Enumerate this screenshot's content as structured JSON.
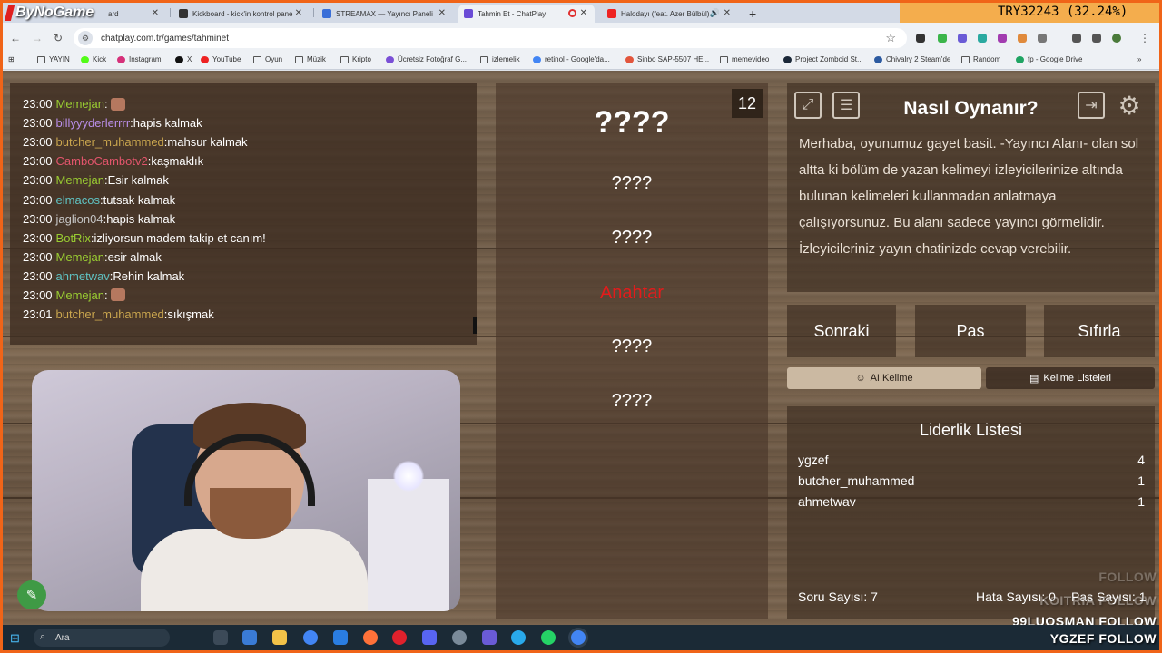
{
  "browser": {
    "tabs": [
      {
        "label": "ard",
        "active": false
      },
      {
        "label": "Kickboard - kick'in kontrol pane",
        "active": false
      },
      {
        "label": "STREAMAX — Yayıncı Paneli",
        "active": false
      },
      {
        "label": "Tahmin Et - ChatPlay",
        "active": true
      },
      {
        "label": "Halodayı (feat. Azer Bülbül)",
        "active": false
      }
    ],
    "new_tab": "+",
    "url": "chatplay.com.tr/games/tahminet",
    "bookmarks": [
      "YAYIN",
      "Kick",
      "Instagram",
      "X",
      "YouTube",
      "Oyun",
      "Müzik",
      "Kripto",
      "Ücretsiz Fotoğraf G...",
      "izlemelik",
      "retinol - Google'da...",
      "Sinbo SAP-5507 HE...",
      "memevideo",
      "Project Zomboid St...",
      "Chivalry 2 Steam'de",
      "Random",
      "fp - Google Drive"
    ]
  },
  "overlay": {
    "brand": "ByNoGame",
    "currency": "TRY32243 (32.24%)",
    "follows": [
      "FOLLOW",
      "KOITRIA FOLLOW",
      "99LUOSMAN  FOLLOW",
      "YGZEF  FOLLOW"
    ]
  },
  "chat": [
    {
      "time": "23:00",
      "user": "Memejan",
      "color": "#9acd32",
      "msg": "",
      "emote": true
    },
    {
      "time": "23:00",
      "user": "billyyyderlerrrr",
      "color": "#b98ee8",
      "msg": "hapis kalmak"
    },
    {
      "time": "23:00",
      "user": "butcher_muhammed",
      "color": "#c9a54e",
      "msg": "mahsur kalmak"
    },
    {
      "time": "23:00",
      "user": "CamboCambotv2",
      "color": "#e2556c",
      "msg": "kaşmaklık"
    },
    {
      "time": "23:00",
      "user": "Memejan",
      "color": "#9acd32",
      "msg": "Esir kalmak"
    },
    {
      "time": "23:00",
      "user": "elmacos",
      "color": "#5fc2c2",
      "msg": "tutsak kalmak"
    },
    {
      "time": "23:00",
      "user": "jaglion04",
      "color": "#c6c6c6",
      "msg": "hapis kalmak"
    },
    {
      "time": "23:00",
      "user": "BotRix",
      "color": "#9acd32",
      "msg": "izliyorsun madem takip et canım!"
    },
    {
      "time": "23:00",
      "user": "Memejan",
      "color": "#9acd32",
      "msg": "esir almak"
    },
    {
      "time": "23:00",
      "user": "ahmetwav",
      "color": "#5fc2c2",
      "msg": "Rehin kalmak"
    },
    {
      "time": "23:00",
      "user": "Memejan",
      "color": "#9acd32",
      "msg": "",
      "emote": true
    },
    {
      "time": "23:01",
      "user": "butcher_muhammed",
      "color": "#c9a54e",
      "msg": "sıkışmak"
    }
  ],
  "game": {
    "counter": "12",
    "main_word": "????",
    "hidden_words": [
      "????",
      "????",
      "????",
      "????"
    ],
    "key_word": "Anahtar",
    "how_to_title": "Nasıl Oynanır?",
    "how_to_text": "Merhaba, oyunumuz gayet basit. -Yayıncı Alanı- olan sol altta ki bölüm de yazan kelimeyi izleyicilerinize altında bulunan kelimeleri kullanmadan anlatmaya çalışıyorsunuz. Bu alanı sadece yayıncı görmelidir. İzleyicileriniz yayın chatinizde cevap verebilir.",
    "buttons": {
      "next": "Sonraki",
      "pass": "Pas",
      "reset": "Sıfırla"
    },
    "ai_word": "AI Kelime",
    "word_lists": "Kelime Listeleri",
    "leaderboard_title": "Liderlik Listesi",
    "leaderboard": [
      {
        "name": "ygzef",
        "score": "4"
      },
      {
        "name": "butcher_muhammed",
        "score": "1"
      },
      {
        "name": "ahmetwav",
        "score": "1"
      }
    ],
    "question_count": "Soru Sayısı: 7",
    "error_count": "Hata Sayısı: 0",
    "pass_count": "Pas Sayısı: 1"
  },
  "taskbar": {
    "search_placeholder": "Ara"
  },
  "colors": {
    "accent_orange": "#f06418",
    "key_red": "#e31b1b",
    "wood": "#6c5946"
  }
}
